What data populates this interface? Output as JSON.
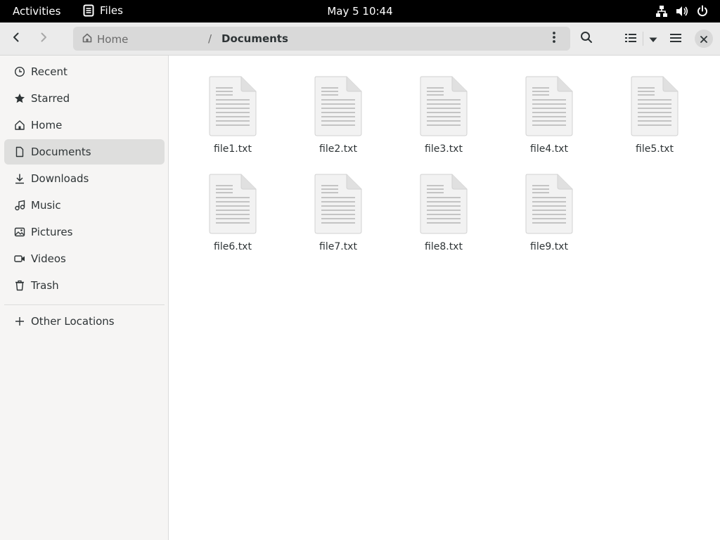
{
  "topbar": {
    "activities": "Activities",
    "app_name": "Files",
    "clock": "May 5  10:44",
    "tray_icons": [
      "network-icon",
      "volume-icon",
      "power-icon"
    ]
  },
  "headerbar": {
    "breadcrumb": {
      "home": "Home",
      "separator": "/",
      "current": "Documents"
    }
  },
  "sidebar": {
    "items": [
      {
        "label": "Recent",
        "icon": "clock-icon"
      },
      {
        "label": "Starred",
        "icon": "star-icon"
      },
      {
        "label": "Home",
        "icon": "home-icon"
      },
      {
        "label": "Documents",
        "icon": "document-icon",
        "selected": true
      },
      {
        "label": "Downloads",
        "icon": "download-icon"
      },
      {
        "label": "Music",
        "icon": "music-icon"
      },
      {
        "label": "Pictures",
        "icon": "picture-icon"
      },
      {
        "label": "Videos",
        "icon": "video-icon"
      },
      {
        "label": "Trash",
        "icon": "trash-icon"
      }
    ],
    "other_locations": "Other Locations"
  },
  "files": [
    {
      "name": "file1.txt"
    },
    {
      "name": "file2.txt"
    },
    {
      "name": "file3.txt"
    },
    {
      "name": "file4.txt"
    },
    {
      "name": "file5.txt"
    },
    {
      "name": "file6.txt"
    },
    {
      "name": "file7.txt"
    },
    {
      "name": "file8.txt"
    },
    {
      "name": "file9.txt"
    }
  ],
  "colors": {
    "topbar_bg": "#000000",
    "headerbar_bg": "#ebebeb",
    "sidebar_bg": "#f6f5f4",
    "selected_bg": "#dededd"
  }
}
